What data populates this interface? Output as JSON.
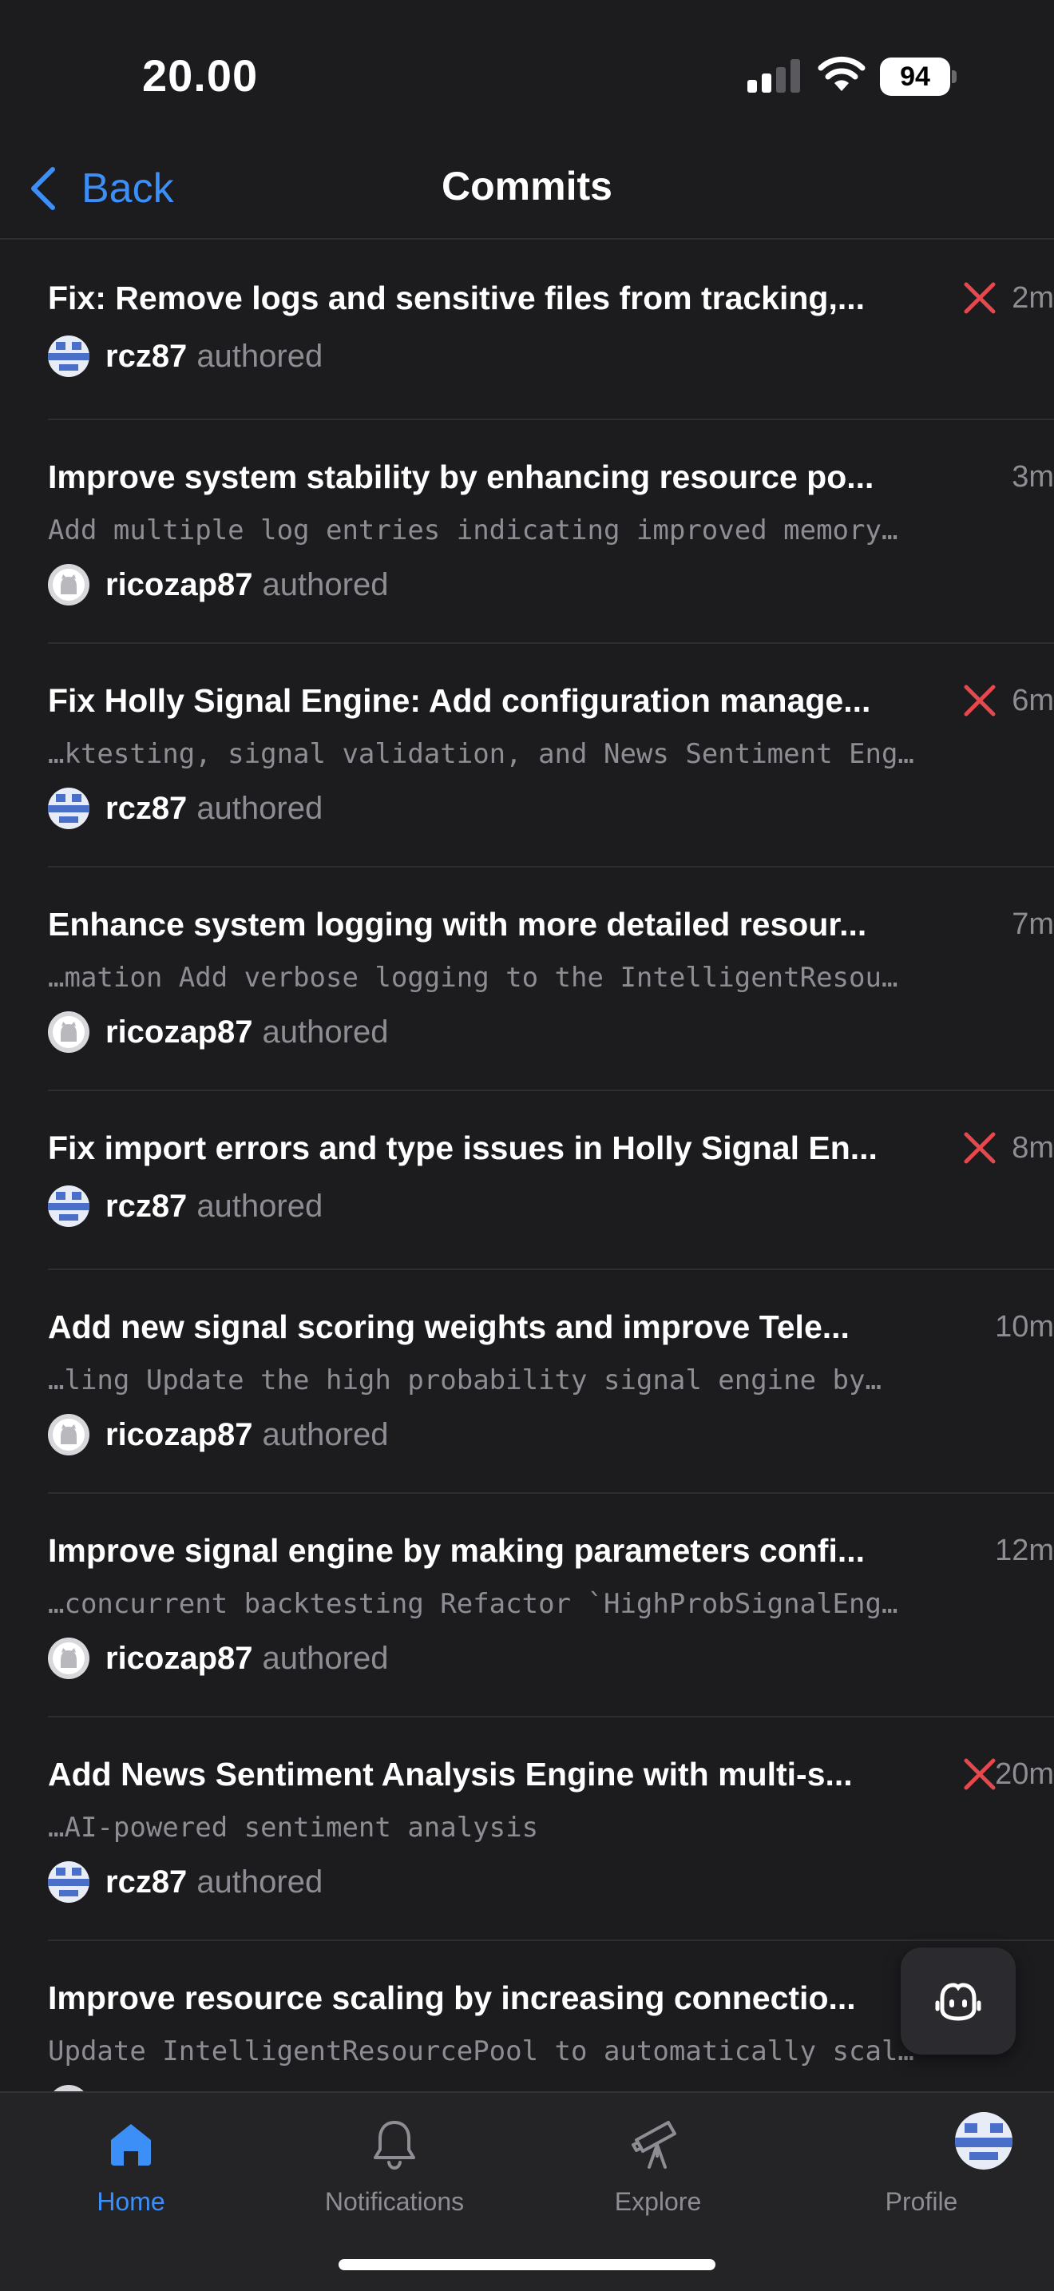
{
  "status_bar": {
    "time": "20.00",
    "battery": "94"
  },
  "nav": {
    "back_label": "Back",
    "title": "Commits"
  },
  "commits": [
    {
      "title": "Fix: Remove logs and sensitive files from tracking,...",
      "description": "",
      "time": "2m",
      "failed": true,
      "author": "rcz87",
      "verb": "authored",
      "avatar": "pixel"
    },
    {
      "title": "Improve system stability by enhancing resource po...",
      "description": "Add multiple log entries indicating improved memory…",
      "time": "3m",
      "failed": false,
      "author": "ricozap87",
      "verb": "authored",
      "avatar": "github"
    },
    {
      "title": "Fix Holly Signal Engine: Add configuration manage...",
      "description": "…ktesting, signal validation, and News Sentiment Eng…",
      "time": "6m",
      "failed": true,
      "author": "rcz87",
      "verb": "authored",
      "avatar": "pixel"
    },
    {
      "title": "Enhance system logging with more detailed resour...",
      "description": "…mation  Add verbose logging to the IntelligentResou…",
      "time": "7m",
      "failed": false,
      "author": "ricozap87",
      "verb": "authored",
      "avatar": "github"
    },
    {
      "title": "Fix import errors and type issues in Holly Signal En...",
      "description": "",
      "time": "8m",
      "failed": true,
      "author": "rcz87",
      "verb": "authored",
      "avatar": "pixel"
    },
    {
      "title": "Add new signal scoring weights and improve Tele...",
      "description": "…ling  Update the high probability signal engine by…",
      "time": "10m",
      "failed": false,
      "author": "ricozap87",
      "verb": "authored",
      "avatar": "github"
    },
    {
      "title": "Improve signal engine by making parameters confi...",
      "description": "…concurrent backtesting  Refactor `HighProbSignalEng…",
      "time": "12m",
      "failed": false,
      "author": "ricozap87",
      "verb": "authored",
      "avatar": "github"
    },
    {
      "title": "Add News Sentiment Analysis Engine with multi-s...",
      "description": "…AI-powered sentiment analysis",
      "time": "20m",
      "failed": true,
      "author": "rcz87",
      "verb": "authored",
      "avatar": "pixel"
    },
    {
      "title": "Improve resource scaling by increasing connectio...",
      "description": "Update IntelligentResourcePool to automatically scal…",
      "time": "",
      "failed": false,
      "author": "",
      "verb": "",
      "avatar": "github"
    }
  ],
  "tabs": [
    {
      "label": "Home",
      "icon": "home-icon",
      "active": true
    },
    {
      "label": "Notifications",
      "icon": "bell-icon",
      "active": false
    },
    {
      "label": "Explore",
      "icon": "telescope-icon",
      "active": false
    },
    {
      "label": "Profile",
      "icon": "profile-avatar",
      "active": false
    }
  ],
  "colors": {
    "accent": "#3b8ff6",
    "failure": "#e5484d",
    "background": "#1c1c1f",
    "secondary_text": "#8d8d93"
  }
}
